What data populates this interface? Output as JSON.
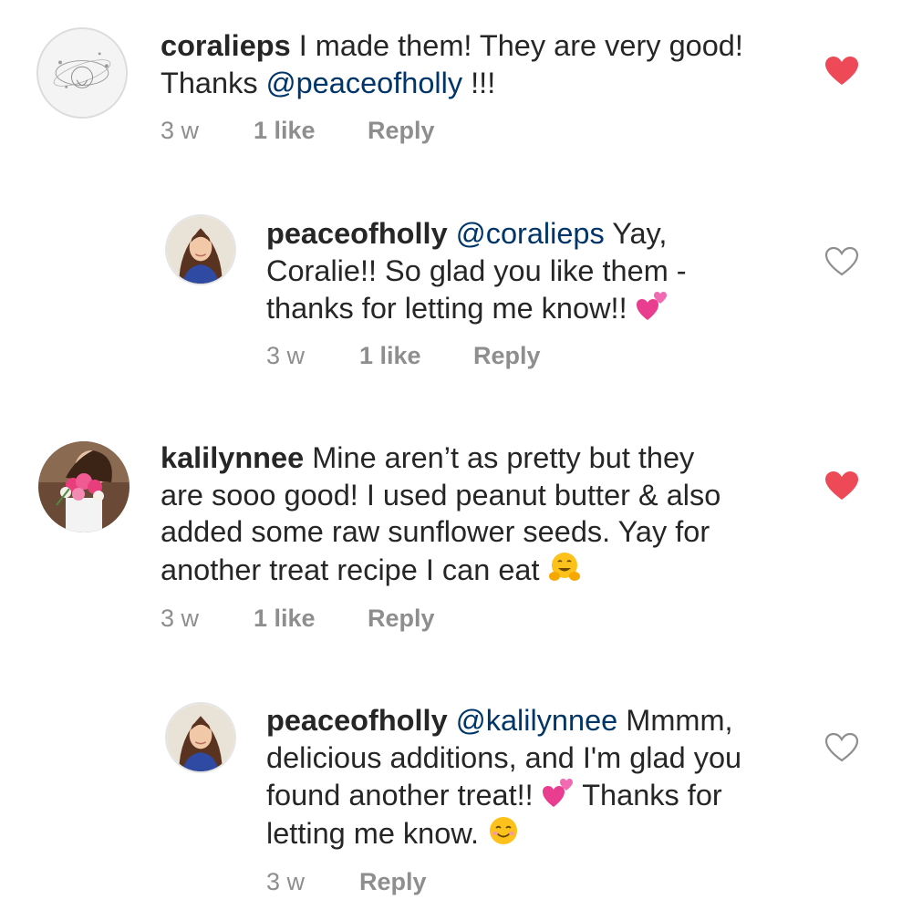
{
  "comments": [
    {
      "username": "coralieps",
      "text_before": " I made them! They are very good!",
      "line2_before": "Thanks ",
      "mention": "@peaceofholly",
      "line2_after": " !!!",
      "time": "3 w",
      "likes": "1 like",
      "reply": "Reply",
      "liked": true
    },
    {
      "username": "peaceofholly",
      "mention": "@coralieps",
      "line1_after": " Yay,",
      "line2": "Coralie!! So glad you like them -",
      "line3": "thanks for letting me know!! ",
      "emoji": "two-hearts",
      "time": "3 w",
      "likes": "1 like",
      "reply": "Reply",
      "liked": false
    },
    {
      "username": "kalilynnee",
      "line1_after": " Mine aren’t as pretty but they",
      "line2": "are sooo good! I used peanut butter & also",
      "line3": "added some raw sunflower seeds. Yay for",
      "line4": "another treat recipe I can eat ",
      "emoji": "hugging-face",
      "time": "3 w",
      "likes": "1 like",
      "reply": "Reply",
      "liked": true
    },
    {
      "username": "peaceofholly",
      "mention": "@kalilynnee",
      "line1_after": " Mmmm,",
      "line2": "delicious additions, and I'm glad you",
      "line3_before": "found another treat!! ",
      "line3_after": " Thanks for",
      "line4": "letting me know. ",
      "emoji1": "two-hearts",
      "emoji2": "smiling-face",
      "time": "3 w",
      "reply": "Reply",
      "liked": false
    }
  ],
  "colors": {
    "text": "#262626",
    "mention": "#003569",
    "meta": "#8e8e8e",
    "heart_liked": "#ed4956",
    "heart_outline": "#8e8e8e"
  }
}
